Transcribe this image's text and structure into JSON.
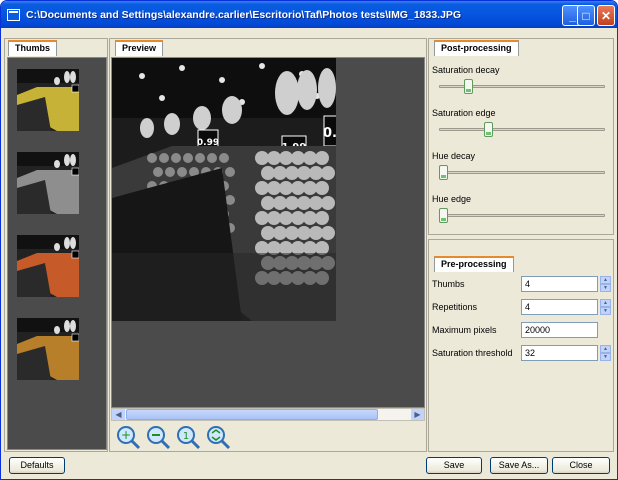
{
  "window": {
    "title": "C:\\Documents and Settings\\alexandre.carlier\\Escritorio\\Taf\\Photos tests\\IMG_1833.JPG"
  },
  "titlebar_buttons": {
    "minimize": "_",
    "maximize": "□",
    "close": "✕"
  },
  "thumbs": {
    "tab": "Thumbs",
    "items": [
      {
        "tint": "#d8c23a"
      },
      {
        "tint": "#9a9a9a"
      },
      {
        "tint": "#d8622a"
      },
      {
        "tint": "#c98a2c"
      }
    ]
  },
  "preview": {
    "tab": "Preview",
    "zoom_buttons": [
      "zoom-in",
      "zoom-out",
      "zoom-reset",
      "zoom-fit"
    ],
    "price_tags": [
      "0.99",
      "1.99",
      "0.99"
    ]
  },
  "post_processing": {
    "tab": "Post-processing",
    "sliders": [
      {
        "label": "Saturation decay",
        "value": 0.15
      },
      {
        "label": "Saturation edge",
        "value": 0.27
      },
      {
        "label": "Hue decay",
        "value": 0.0
      },
      {
        "label": "Hue edge",
        "value": 0.0
      }
    ]
  },
  "pre_processing": {
    "tab": "Pre-processing",
    "fields": [
      {
        "label": "Thumbs",
        "value": "4",
        "spin": true
      },
      {
        "label": "Repetitions",
        "value": "4",
        "spin": true
      },
      {
        "label": "Maximum pixels",
        "value": "20000",
        "spin": false
      },
      {
        "label": "Saturation threshold",
        "value": "32",
        "spin": true
      }
    ]
  },
  "buttons": {
    "defaults": "Defaults",
    "save": "Save",
    "save_as": "Save As...",
    "close": "Close"
  }
}
